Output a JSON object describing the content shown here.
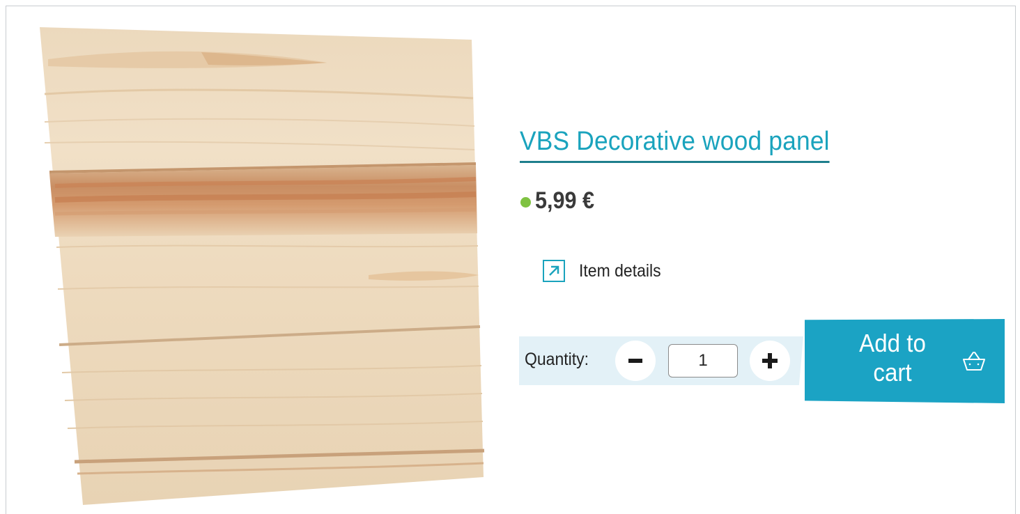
{
  "product": {
    "title": "VBS Decorative wood panel",
    "price": "5,99 €",
    "availability_color": "#7fc241",
    "image_subject": "wood-panel"
  },
  "details_link": {
    "label": "Item details",
    "icon": "external-arrow-icon"
  },
  "quantity": {
    "label": "Quantity:",
    "value": "1",
    "minus_icon": "minus-icon",
    "plus_icon": "plus-icon"
  },
  "cart": {
    "label_line1": "Add to",
    "label_line2": "cart",
    "icon": "basket-icon"
  },
  "colors": {
    "accent": "#1ba3c4",
    "title_link": "#1aa3bd",
    "quantity_band": "#e3f1f7"
  }
}
